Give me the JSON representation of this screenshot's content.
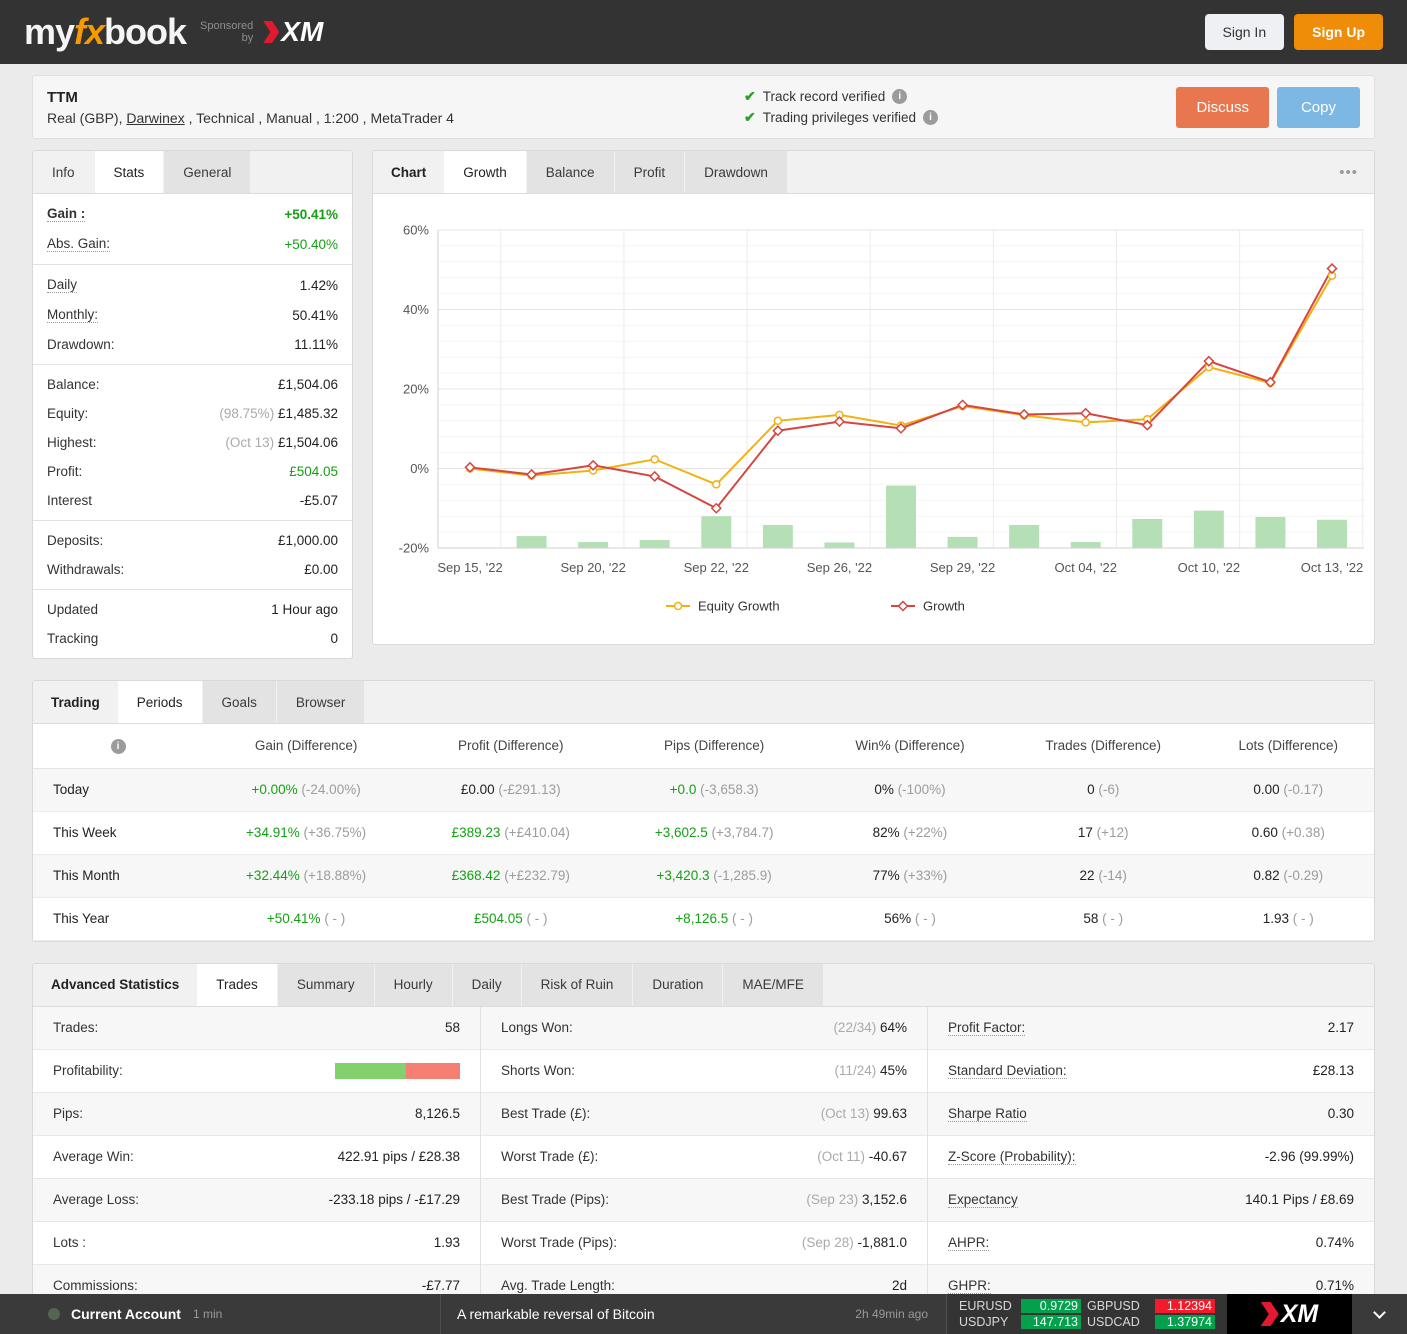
{
  "nav": {
    "logo_my": "my",
    "logo_fx": "fx",
    "logo_book": "book",
    "sponsored_line1": "Sponsored",
    "sponsored_line2": "by",
    "xm_text": "XM",
    "sign_in": "Sign In",
    "sign_up": "Sign Up"
  },
  "account": {
    "title": "TTM",
    "sub_prefix": "Real (GBP), ",
    "sub_link": "Darwinex",
    "sub_suffix": " , Technical , Manual , 1:200 , MetaTrader 4",
    "check_icon": "✔",
    "info_icon": "i",
    "verified1": "Track record verified",
    "verified2": "Trading privileges verified",
    "discuss": "Discuss",
    "copy": "Copy"
  },
  "stats_panel": {
    "tabs": [
      "Info",
      "Stats",
      "General"
    ],
    "active": "Stats",
    "groups": [
      [
        {
          "label": "Gain :",
          "dotted": true,
          "bold": true,
          "value": "+50.41%",
          "cls": "green bold"
        },
        {
          "label": "Abs. Gain:",
          "dotted": true,
          "value": "+50.40%",
          "cls": "green"
        }
      ],
      [
        {
          "label": "Daily",
          "dotted": true,
          "value": "1.42%"
        },
        {
          "label": "Monthly:",
          "dotted": true,
          "value": "50.41%"
        },
        {
          "label": "Drawdown:",
          "value": "11.11%"
        }
      ],
      [
        {
          "label": "Balance:",
          "value": "£1,504.06"
        },
        {
          "label": "Equity:",
          "muted": "(98.75%)",
          "value": "£1,485.32"
        },
        {
          "label": "Highest:",
          "muted": "(Oct 13)",
          "value": "£1,504.06"
        },
        {
          "label": "Profit:",
          "value": "£504.05",
          "cls": "green"
        },
        {
          "label": "Interest",
          "value": "-£5.07"
        }
      ],
      [
        {
          "label": "Deposits:",
          "value": "£1,000.00"
        },
        {
          "label": "Withdrawals:",
          "value": "£0.00"
        }
      ],
      [
        {
          "label": "Updated",
          "value": "1 Hour ago"
        },
        {
          "label": "Tracking",
          "value": "0"
        }
      ]
    ]
  },
  "chart_panel": {
    "title": "Chart",
    "tabs": [
      "Growth",
      "Balance",
      "Profit",
      "Drawdown"
    ],
    "active": "Growth",
    "menu_dots": "•••",
    "legend": [
      {
        "name": "Equity Growth",
        "color": "#f2b113",
        "marker": "circle"
      },
      {
        "name": "Growth",
        "color": "#d64540",
        "marker": "diamond"
      }
    ]
  },
  "chart_data": {
    "type": "line+bar",
    "title": "Growth",
    "ylim": [
      -20,
      60
    ],
    "grid": true,
    "legend_position": "bottom",
    "yticks": [
      {
        "v": 60,
        "label": "60%"
      },
      {
        "v": 40,
        "label": "40%"
      },
      {
        "v": 20,
        "label": "20%"
      },
      {
        "v": 0,
        "label": "0%"
      },
      {
        "v": -20,
        "label": "-20%"
      }
    ],
    "x_tick_labels": [
      "Sep 15, '22",
      "Sep 20, '22",
      "Sep 22, '22",
      "Sep 26, '22",
      "Sep 29, '22",
      "Oct 04, '22",
      "Oct 10, '22",
      "Oct 13, '22"
    ],
    "tick_indices": [
      0,
      2,
      4,
      6,
      8,
      10,
      12,
      14
    ],
    "series": [
      {
        "name": "Equity Growth",
        "color": "#f2b113",
        "marker": "circle",
        "values": [
          0.0,
          -1.8,
          -0.5,
          2.3,
          -4.0,
          12.0,
          13.5,
          10.8,
          15.7,
          13.4,
          11.6,
          12.4,
          25.5,
          21.5,
          48.5
        ]
      },
      {
        "name": "Growth",
        "color": "#d64540",
        "marker": "diamond",
        "values": [
          0.3,
          -1.5,
          0.8,
          -2.0,
          -10.0,
          9.5,
          11.8,
          10.1,
          16.0,
          13.6,
          13.9,
          10.9,
          27.0,
          21.7,
          50.3
        ]
      }
    ],
    "bars": {
      "name": "Activity",
      "color": "#b5dfb5",
      "heights_from_baseline": [
        0,
        3.0,
        1.5,
        2.0,
        8.0,
        5.8,
        1.4,
        15.7,
        2.8,
        5.8,
        1.5,
        7.3,
        9.4,
        7.8,
        7.1
      ]
    }
  },
  "periods_panel": {
    "title": "Trading",
    "tabs": [
      "Periods",
      "Goals",
      "Browser"
    ],
    "active": "Periods",
    "info_icon": "i",
    "columns": [
      "Gain (Difference)",
      "Profit (Difference)",
      "Pips (Difference)",
      "Win% (Difference)",
      "Trades (Difference)",
      "Lots (Difference)"
    ],
    "rows": [
      {
        "label": "Today",
        "cells": [
          {
            "main": "+0.00%",
            "diff": "(-24.00%)",
            "green": true
          },
          {
            "main": "£0.00",
            "diff": "(-£291.13)"
          },
          {
            "main": "+0.0",
            "diff": "(-3,658.3)",
            "green": true
          },
          {
            "main": "0%",
            "diff": "(-100%)"
          },
          {
            "main": "0",
            "diff": "(-6)"
          },
          {
            "main": "0.00",
            "diff": "(-0.17)"
          }
        ]
      },
      {
        "label": "This Week",
        "cells": [
          {
            "main": "+34.91%",
            "diff": "(+36.75%)",
            "green": true
          },
          {
            "main": "£389.23",
            "diff": "(+£410.04)",
            "green": true
          },
          {
            "main": "+3,602.5",
            "diff": "(+3,784.7)",
            "green": true
          },
          {
            "main": "82%",
            "diff": "(+22%)"
          },
          {
            "main": "17",
            "diff": "(+12)"
          },
          {
            "main": "0.60",
            "diff": "(+0.38)"
          }
        ]
      },
      {
        "label": "This Month",
        "cells": [
          {
            "main": "+32.44%",
            "diff": "(+18.88%)",
            "green": true
          },
          {
            "main": "£368.42",
            "diff": "(+£232.79)",
            "green": true
          },
          {
            "main": "+3,420.3",
            "diff": "(-1,285.9)",
            "green": true
          },
          {
            "main": "77%",
            "diff": "(+33%)"
          },
          {
            "main": "22",
            "diff": "(-14)"
          },
          {
            "main": "0.82",
            "diff": "(-0.29)"
          }
        ]
      },
      {
        "label": "This Year",
        "cells": [
          {
            "main": "+50.41%",
            "diff": "( - )",
            "green": true
          },
          {
            "main": "£504.05",
            "diff": "( - )",
            "green": true
          },
          {
            "main": "+8,126.5",
            "diff": "( - )",
            "green": true
          },
          {
            "main": "56%",
            "diff": "( - )"
          },
          {
            "main": "58",
            "diff": "( - )"
          },
          {
            "main": "1.93",
            "diff": "( - )"
          }
        ]
      }
    ]
  },
  "advanced_panel": {
    "title": "Advanced Statistics",
    "tabs": [
      "Trades",
      "Summary",
      "Hourly",
      "Daily",
      "Risk of Ruin",
      "Duration",
      "MAE/MFE"
    ],
    "active": "Trades",
    "profitability_bar": {
      "green_pct": 57,
      "green_color": "#83d06e",
      "red_color": "#f57f72"
    },
    "columns": [
      [
        {
          "label": "Trades:",
          "value": "58"
        },
        {
          "label": "Profitability:",
          "type": "bar"
        },
        {
          "label": "Pips:",
          "value": "8,126.5"
        },
        {
          "label": "Average Win:",
          "value": "422.91 pips / £28.38"
        },
        {
          "label": "Average Loss:",
          "value": "-233.18 pips / -£17.29"
        },
        {
          "label": "Lots :",
          "value": "1.93"
        },
        {
          "label": "Commissions:",
          "value": "-£7.77"
        }
      ],
      [
        {
          "label": "Longs Won:",
          "muted": "(22/34)",
          "value": "64%"
        },
        {
          "label": "Shorts Won:",
          "muted": "(11/24)",
          "value": "45%"
        },
        {
          "label": "Best Trade (£):",
          "muted": "(Oct 13)",
          "value": "99.63"
        },
        {
          "label": "Worst Trade (£):",
          "muted": "(Oct 11)",
          "value": "-40.67"
        },
        {
          "label": "Best Trade (Pips):",
          "muted": "(Sep 23)",
          "value": "3,152.6"
        },
        {
          "label": "Worst Trade (Pips):",
          "muted": "(Sep 28)",
          "value": "-1,881.0"
        },
        {
          "label": "Avg. Trade Length:",
          "value": "2d"
        }
      ],
      [
        {
          "label": "Profit Factor:",
          "dotted": true,
          "value": "2.17"
        },
        {
          "label": "Standard Deviation:",
          "dotted": true,
          "value": "£28.13"
        },
        {
          "label": "Sharpe Ratio",
          "dotted": true,
          "value": "0.30"
        },
        {
          "label": "Z-Score (Probability):",
          "dotted": true,
          "value": "-2.96 (99.99%)"
        },
        {
          "label": "Expectancy",
          "dotted": true,
          "value": "140.1 Pips / £8.69"
        },
        {
          "label": "AHPR:",
          "dotted": true,
          "value": "0.74%"
        },
        {
          "label": "GHPR:",
          "dotted": true,
          "value": "0.71%"
        }
      ]
    ]
  },
  "ticker": {
    "status_label": "Current Account",
    "status_time": "1 min",
    "news": "A remarkable reversal of Bitcoin",
    "news_time": "2h 49min ago",
    "quotes": [
      {
        "symbol": "EURUSD",
        "price": "0.9729",
        "dir": "up"
      },
      {
        "symbol": "GBPUSD",
        "price": "1.12394",
        "dir": "down"
      },
      {
        "symbol": "USDJPY",
        "price": "147.713",
        "dir": "up"
      },
      {
        "symbol": "USDCAD",
        "price": "1.37974",
        "dir": "up"
      }
    ],
    "xm_text": "XM"
  }
}
